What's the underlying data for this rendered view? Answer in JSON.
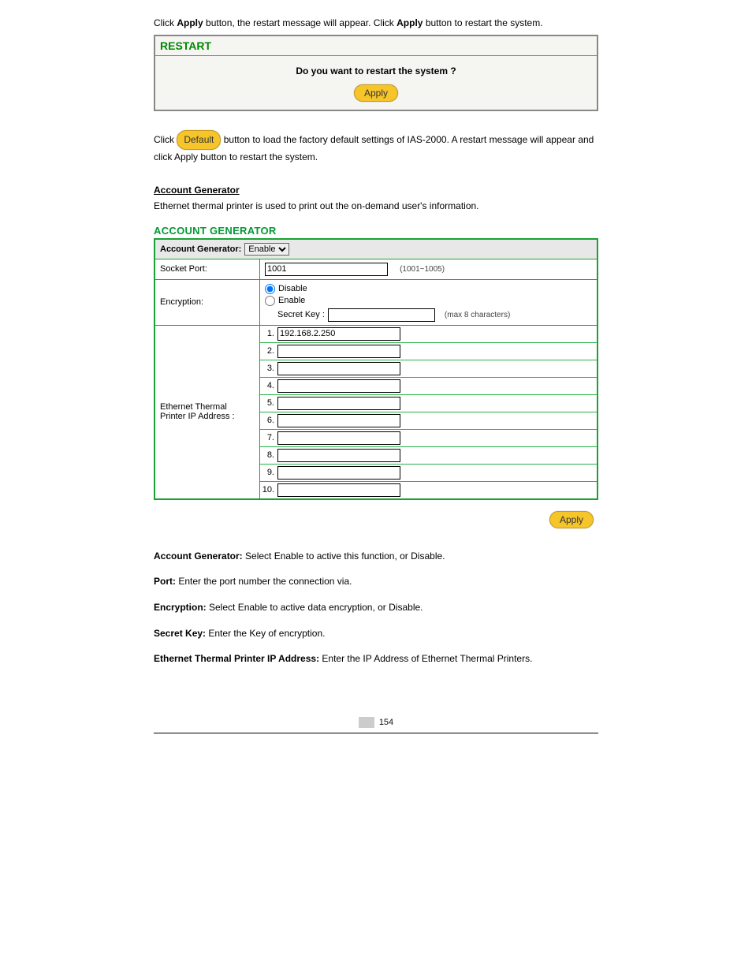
{
  "intro": {
    "prefix": "Click ",
    "apply1": "Apply",
    "mid": " button, the restart message will appear. Click ",
    "apply2": "Apply",
    "suffix": " button to restart the system."
  },
  "restart": {
    "header": "RESTART",
    "question": "Do you want to restart the system ?",
    "apply_label": "Apply"
  },
  "default_para": {
    "text_before": "Click ",
    "button_label": "Default",
    "text_after": " button to load the factory default settings of IAS-2000. A restart message will appear and click Apply button to restart the system."
  },
  "ag_section": {
    "title": "Account Generator",
    "desc": "Ethernet thermal printer is used to print out the on-demand user's information.",
    "panel_title": "ACCOUNT GENERATOR",
    "top_label": "Account Generator:",
    "enable_option": "Enable",
    "socket_label": "Socket Port:",
    "socket_value": "1001",
    "socket_hint": "(1001~1005)",
    "encryption_label": "Encryption:",
    "disable_label": "Disable",
    "enable_label": "Enable",
    "secret_label": "Secret Key :",
    "secret_value": "",
    "secret_hint": "(max 8 characters)",
    "printer_label_line1": "Ethernet Thermal",
    "printer_label_line2": "Printer IP Address :",
    "ip_rows": [
      {
        "num": "1.",
        "value": "192.168.2.250"
      },
      {
        "num": "2.",
        "value": ""
      },
      {
        "num": "3.",
        "value": ""
      },
      {
        "num": "4.",
        "value": ""
      },
      {
        "num": "5.",
        "value": ""
      },
      {
        "num": "6.",
        "value": ""
      },
      {
        "num": "7.",
        "value": ""
      },
      {
        "num": "8.",
        "value": ""
      },
      {
        "num": "9.",
        "value": ""
      },
      {
        "num": "10.",
        "value": ""
      }
    ],
    "apply_label": "Apply"
  },
  "bullets": {
    "b1_label": "Account Generator:",
    "b1_text": " Select Enable to active this function, or Disable.",
    "b2_label": "Port:",
    "b2_text": " Enter the port number the connection via.",
    "b3_label": "Encryption:",
    "b3_text": " Select Enable to active data encryption, or Disable.",
    "b4_label": "Secret Key:",
    "b4_text": " Enter the Key of encryption.",
    "b5_label": "Ethernet Thermal Printer IP Address:",
    "b5_text": " Enter the IP Address of Ethernet Thermal Printers."
  },
  "page_number": "154"
}
